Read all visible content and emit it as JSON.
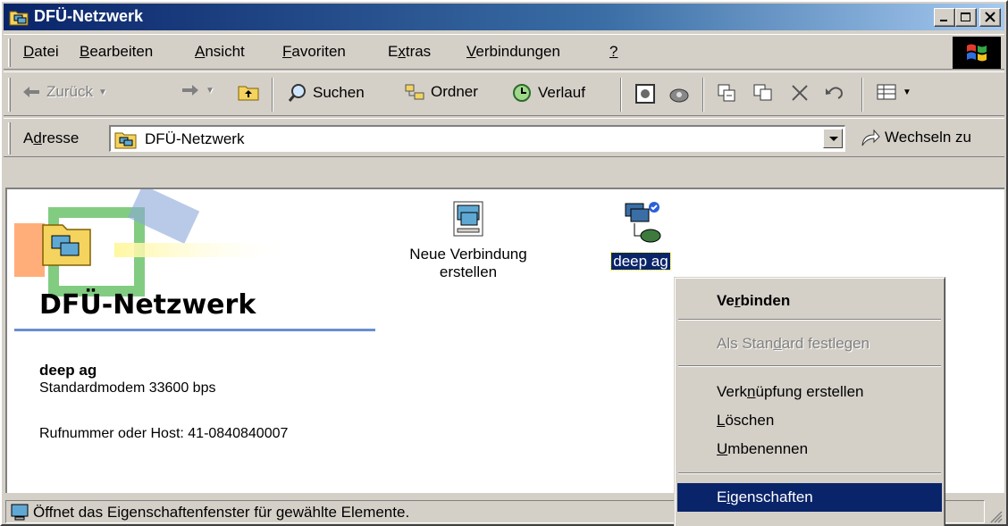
{
  "window": {
    "title": "DFÜ-Netzwerk"
  },
  "menubar": {
    "items": [
      {
        "pre": "",
        "key": "D",
        "post": "atei"
      },
      {
        "pre": "",
        "key": "B",
        "post": "earbeiten"
      },
      {
        "pre": "",
        "key": "A",
        "post": "nsicht"
      },
      {
        "pre": "",
        "key": "F",
        "post": "avoriten"
      },
      {
        "pre": "E",
        "key": "x",
        "post": "tras"
      },
      {
        "pre": "",
        "key": "V",
        "post": "erbindungen"
      },
      {
        "pre": "",
        "key": "?",
        "post": ""
      }
    ]
  },
  "toolbar": {
    "back_label": "Zurück",
    "search_label": "Suchen",
    "folders_label": "Ordner",
    "history_label": "Verlauf"
  },
  "address": {
    "label_pre": "A",
    "label_key": "d",
    "label_post": "resse",
    "value": "DFÜ-Netzwerk",
    "go_label": "Wechseln zu"
  },
  "content": {
    "section_title": "DFÜ-Netzwerk",
    "details": {
      "name": "deep ag",
      "modem": "Standardmodem 33600 bps",
      "phone": "Rufnummer oder Host: 41-0840840007"
    },
    "icons": [
      {
        "label_line1": "Neue Verbindung",
        "label_line2": "erstellen"
      },
      {
        "label_line1": "deep ag"
      }
    ]
  },
  "context_menu": {
    "items": [
      {
        "pre": "Ve",
        "key": "r",
        "post": "binden"
      },
      {
        "pre": "Als Stan",
        "key": "d",
        "post": "ard festlegen"
      },
      {
        "pre": "Verk",
        "key": "n",
        "post": "üpfung erstellen"
      },
      {
        "pre": "",
        "key": "L",
        "post": "öschen"
      },
      {
        "pre": "",
        "key": "U",
        "post": "mbenennen"
      },
      {
        "pre": "E",
        "key": "i",
        "post": "genschaften"
      }
    ]
  },
  "statusbar": {
    "text": "Öffnet das Eigenschaftenfenster für gewählte Elemente."
  }
}
